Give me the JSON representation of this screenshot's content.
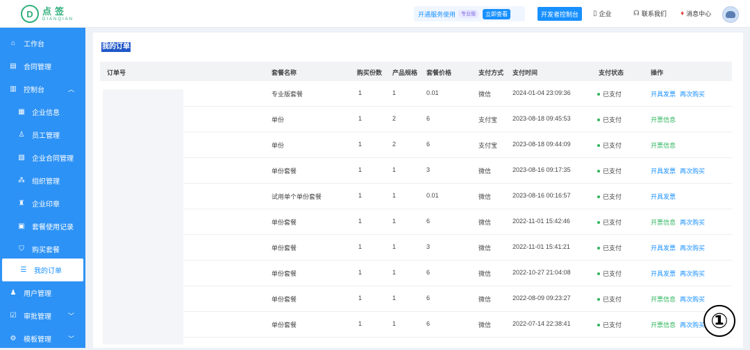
{
  "header": {
    "logo_cn": "点签",
    "logo_en": "DIANQIAN",
    "promo_text": "开通服务使用",
    "promo_badge": "专业版",
    "promo_button": "立即查看",
    "console_button": "开发者控制台",
    "links": [
      {
        "label": "企业",
        "icon": "building-icon"
      },
      {
        "label": "联系我们",
        "icon": "headset-icon"
      },
      {
        "label": "消息中心",
        "icon": "bell-icon"
      }
    ]
  },
  "sidebar": {
    "items": [
      {
        "label": "工作台",
        "icon": "home-icon",
        "level": "top"
      },
      {
        "label": "合同管理",
        "icon": "document-icon",
        "level": "top"
      },
      {
        "label": "控制台",
        "icon": "chart-icon",
        "level": "top",
        "arrow": "up"
      },
      {
        "label": "企业信息",
        "icon": "info-icon",
        "level": "sub"
      },
      {
        "label": "员工管理",
        "icon": "user-icon",
        "level": "sub"
      },
      {
        "label": "企业合同管理",
        "icon": "contract-icon",
        "level": "sub"
      },
      {
        "label": "组织管理",
        "icon": "org-icon",
        "level": "sub"
      },
      {
        "label": "企业印章",
        "icon": "stamp-icon",
        "level": "sub"
      },
      {
        "label": "套餐使用记录",
        "icon": "record-icon",
        "level": "sub"
      },
      {
        "label": "购买套餐",
        "icon": "cart-icon",
        "level": "sub"
      },
      {
        "label": "我的订单",
        "icon": "order-icon",
        "level": "sub",
        "active": true
      },
      {
        "label": "用户管理",
        "icon": "user-manage-icon",
        "level": "top"
      },
      {
        "label": "审批管理",
        "icon": "approval-icon",
        "level": "top",
        "arrow": "down"
      },
      {
        "label": "模板管理",
        "icon": "template-icon",
        "level": "top",
        "arrow": "down"
      }
    ]
  },
  "main": {
    "title": "我的订单",
    "columns": [
      "订单号",
      "套餐名称",
      "购买份数",
      "产品规格",
      "套餐价格",
      "支付方式",
      "支付时间",
      "支付状态",
      "操作"
    ],
    "rows": [
      {
        "name": "专业版套餐",
        "qty": "1",
        "spec": "1",
        "price": "0.01",
        "method": "微信",
        "time": "2024-01-04 23:09:36",
        "status": "已支付",
        "actions": [
          {
            "label": "开具发票",
            "color": "blue"
          },
          {
            "label": "再次购买",
            "color": "blue"
          }
        ]
      },
      {
        "name": "单份",
        "qty": "1",
        "spec": "2",
        "price": "6",
        "method": "支付宝",
        "time": "2023-08-18 09:45:53",
        "status": "已支付",
        "actions": [
          {
            "label": "开票信息",
            "color": "green"
          }
        ]
      },
      {
        "name": "单份",
        "qty": "1",
        "spec": "2",
        "price": "6",
        "method": "支付宝",
        "time": "2023-08-18 09:44:09",
        "status": "已支付",
        "actions": [
          {
            "label": "开票信息",
            "color": "green"
          }
        ]
      },
      {
        "name": "单份套餐",
        "qty": "1",
        "spec": "1",
        "price": "3",
        "method": "微信",
        "time": "2023-08-16 09:17:35",
        "status": "已支付",
        "actions": [
          {
            "label": "开具发票",
            "color": "blue"
          },
          {
            "label": "再次购买",
            "color": "blue"
          }
        ]
      },
      {
        "name": "试用单个单份套餐",
        "qty": "1",
        "spec": "1",
        "price": "0.01",
        "method": "微信",
        "time": "2023-08-16 00:16:57",
        "status": "已支付",
        "actions": [
          {
            "label": "开具发票",
            "color": "blue"
          }
        ]
      },
      {
        "name": "单份套餐",
        "qty": "1",
        "spec": "1",
        "price": "6",
        "method": "微信",
        "time": "2022-11-01 15:42:46",
        "status": "已支付",
        "actions": [
          {
            "label": "开票信息",
            "color": "green"
          },
          {
            "label": "再次购买",
            "color": "blue"
          }
        ]
      },
      {
        "name": "单份套餐",
        "qty": "1",
        "spec": "1",
        "price": "3",
        "method": "微信",
        "time": "2022-11-01 15:41:21",
        "status": "已支付",
        "actions": [
          {
            "label": "开具发票",
            "color": "blue"
          },
          {
            "label": "再次购买",
            "color": "blue"
          }
        ]
      },
      {
        "name": "单份套餐",
        "qty": "1",
        "spec": "1",
        "price": "6",
        "method": "微信",
        "time": "2022-10-27 21:04:08",
        "status": "已支付",
        "actions": [
          {
            "label": "开具发票",
            "color": "blue"
          },
          {
            "label": "再次购买",
            "color": "blue"
          }
        ]
      },
      {
        "name": "单份套餐",
        "qty": "1",
        "spec": "1",
        "price": "6",
        "method": "微信",
        "time": "2022-08-09 09:23:27",
        "status": "已支付",
        "actions": [
          {
            "label": "开票信息",
            "color": "green"
          },
          {
            "label": "再次购买",
            "color": "blue"
          }
        ]
      },
      {
        "name": "单份套餐",
        "qty": "1",
        "spec": "1",
        "price": "6",
        "method": "微信",
        "time": "2022-07-14 22:38:41",
        "status": "已支付",
        "actions": [
          {
            "label": "开票信息",
            "color": "green"
          },
          {
            "label": "再次购买",
            "color": "blue"
          }
        ]
      }
    ]
  },
  "marker": "①",
  "colors": {
    "primary": "#1890ff",
    "sidebar": "#2d92f5",
    "success": "#2db55d",
    "brand": "#2fae7b"
  }
}
